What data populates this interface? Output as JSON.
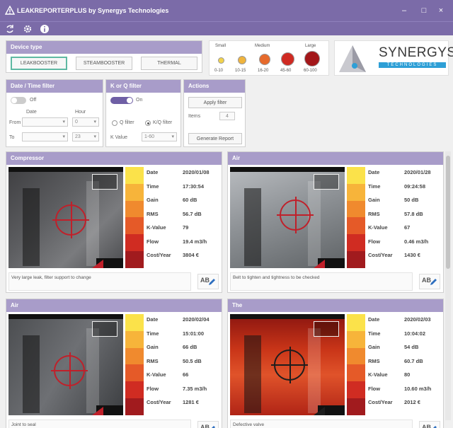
{
  "window": {
    "title": "LEAKREPORTERPLUS by Synergys Technologies",
    "controls": [
      "–",
      "□",
      "×"
    ]
  },
  "toolbar": {
    "icons": [
      "refresh-icon",
      "gear-icon",
      "info-icon"
    ]
  },
  "device_type": {
    "title": "Device type",
    "buttons": [
      "LEAKBOOSTER",
      "STEAMBOOSTER",
      "THERMAL"
    ],
    "active": "LEAKBOOSTER"
  },
  "size_legend": {
    "labels": {
      "small": "Small",
      "medium": "Medium",
      "large": "Large"
    },
    "items": [
      {
        "range": "0-10",
        "color": "#f2d24b"
      },
      {
        "range": "10-15",
        "color": "#f0b43c"
      },
      {
        "range": "16-20",
        "color": "#e66a2c"
      },
      {
        "range": "45-60",
        "color": "#cf2a22"
      },
      {
        "range": "60-100",
        "color": "#a3171a"
      }
    ]
  },
  "logo": {
    "name": "SYNERGYS",
    "tagline": "TECHNOLOGIES"
  },
  "date_filter": {
    "title": "Date / Time filter",
    "toggle_label": "Off",
    "col_date": "Date",
    "col_hour": "Hour",
    "from_label": "From",
    "to_label": "To",
    "from_hour": "0",
    "to_hour": "23"
  },
  "kvalue_filter": {
    "title": "K or Q filter",
    "toggle_label": "On",
    "option_q": "Q filter",
    "option_k": "K/Q filter",
    "kvalue_label": "K Value",
    "kvalue": "1-60"
  },
  "actions": {
    "title": "Actions",
    "apply_label": "Apply filter",
    "items_label": "Items",
    "items_value": "4",
    "report_label": "Generate Report"
  },
  "field_labels": {
    "date": "Date",
    "time": "Time",
    "gain": "Gain",
    "rms": "RMS",
    "kvalue": "K-Value",
    "flow": "Flow",
    "cost": "Cost/Year"
  },
  "ab_label": "AB",
  "cards": [
    {
      "title": "Compressor",
      "date": "2020/01/08",
      "time": "17:30:54",
      "gain": "60 dB",
      "rms": "56.7 dB",
      "kvalue": "79",
      "flow": "19.4 m3/h",
      "cost": "3804 €",
      "comment": "Very large leak, filter support to change"
    },
    {
      "title": "Air",
      "date": "2020/01/28",
      "time": "09:24:58",
      "gain": "50 dB",
      "rms": "57.8 dB",
      "kvalue": "67",
      "flow": "0.46 m3/h",
      "cost": "1430 €",
      "comment": "Belt to tighten and tightness to be checked"
    },
    {
      "title": "Air",
      "date": "2020/02/04",
      "time": "15:01:00",
      "gain": "66 dB",
      "rms": "50.5 dB",
      "kvalue": "66",
      "flow": "7.35 m3/h",
      "cost": "1281 €",
      "comment": "Joint to seal"
    },
    {
      "title": "The",
      "date": "2020/02/03",
      "time": "10:04:02",
      "gain": "54 dB",
      "rms": "60.7 dB",
      "kvalue": "80",
      "flow": "10.60 m3/h",
      "cost": "2012 €",
      "comment": "Defective valve"
    }
  ],
  "colors": {
    "titlebar": "#7b6ba8",
    "panel_header": "#a89cc9",
    "active_border": "#5fb9a3",
    "accent_blue": "#2e9fd6",
    "scale": [
      "#fbe24a",
      "#f7b43a",
      "#f08a2e",
      "#e55a28",
      "#d02c22",
      "#a11b1e"
    ]
  }
}
